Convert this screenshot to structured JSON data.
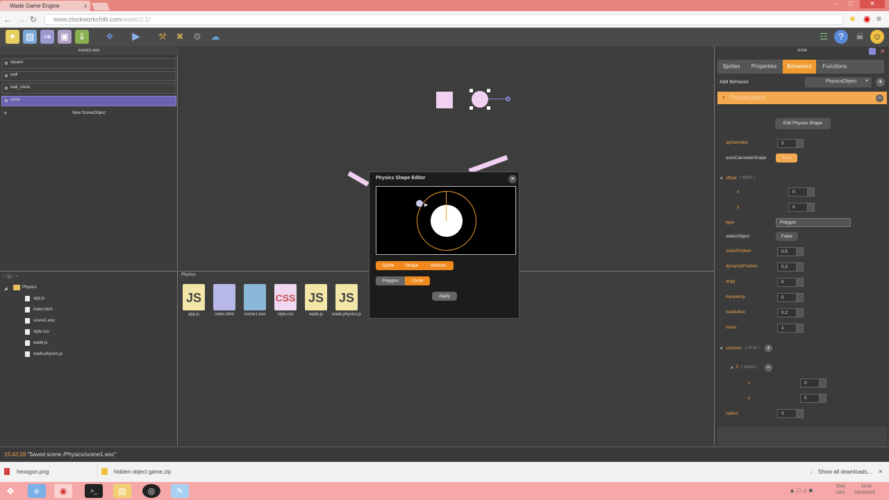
{
  "browser": {
    "tab_title": "Wade Game Engine",
    "tab_close": "x",
    "url_host": "www.clockworkchilli.com",
    "url_path": "/wade/2.1/",
    "window_controls": [
      "–",
      "□",
      "✕"
    ]
  },
  "left_panel": {
    "header": "scene1.wsc",
    "objects": [
      "square",
      "wall",
      "wall_clone",
      "circle"
    ],
    "selected": "circle",
    "new_object": "New SceneObject"
  },
  "project": {
    "root": "Physics",
    "files": [
      "app.js",
      "index.html",
      "scene1.wsc",
      "style.css",
      "wade.js",
      "wade.physics.js"
    ]
  },
  "assets": {
    "header": "Physics",
    "files": [
      {
        "name": "app.js",
        "icon": "JS"
      },
      {
        "name": "index.html",
        "icon": ""
      },
      {
        "name": "scene1.wsc",
        "icon": ""
      },
      {
        "name": "style.css",
        "icon": "CSS"
      },
      {
        "name": "wade.js",
        "icon": "JS"
      },
      {
        "name": "wade.physics.js",
        "icon": "JS"
      }
    ]
  },
  "dialog": {
    "title": "Physics Shape Editor",
    "close": "✕",
    "mode_tabs": [
      "Sprite",
      "Shape",
      "Vertices"
    ],
    "shape_tabs": [
      "Polygon",
      "Circle"
    ],
    "active_shape": "Circle",
    "apply": "Apply"
  },
  "right_panel": {
    "header": "circle",
    "tabs": [
      "Sprites",
      "Properties",
      "Behaviors",
      "Functions"
    ],
    "active_tab": "Behaviors",
    "add_behavior_label": "Add Behavior",
    "add_behavior_value": "PhysicsObject",
    "behavior_title": "PhysicsObject",
    "edit_shape_button": "Edit Physics Shape",
    "props": {
      "spriteIndex": "0",
      "autoCalculateShape_label": "autoCalculateShape",
      "autoCalculateShape": "True",
      "offset_label": "offset",
      "offset_type": "( object )",
      "offset_x": "0",
      "offset_y": "0",
      "type_label": "type",
      "type": "Polygon",
      "staticObject_label": "staticObject",
      "staticObject": "False",
      "staticFriction": "0.5",
      "dynamicFriction": "0.3",
      "drag": "0",
      "buoyancy": "0",
      "restitution": "0.2",
      "mass": "1",
      "vertices_label": "vertices",
      "vertices_type": "( array )",
      "vertex0_label": "0",
      "vertex0_type": "( object )",
      "vertex0_x": "0",
      "vertex0_y": "0",
      "radius": "0"
    },
    "labels": {
      "spriteIndex": "spriteIndex",
      "x": "x",
      "y": "y",
      "staticFriction": "staticFriction",
      "dynamicFriction": "dynamicFriction",
      "drag": "drag",
      "buoyancy": "buoyancy",
      "restitution": "restitution",
      "mass": "mass",
      "radius": "radius"
    }
  },
  "status": {
    "time": "15:42:28",
    "message": "\"Saved scene /Physics/scene1.wsc\""
  },
  "downloads": {
    "items": [
      "hexagon.png",
      "hidden object game.zip"
    ],
    "show_all": "Show all downloads..."
  },
  "taskbar": {
    "lang": "ENG",
    "lang2": "UKX",
    "time": "15:42",
    "date": "23/02/2015"
  },
  "colors": {
    "accent": "#f09a30",
    "selection": "#6b63b0",
    "shape_pink": "#f2d0f2"
  }
}
